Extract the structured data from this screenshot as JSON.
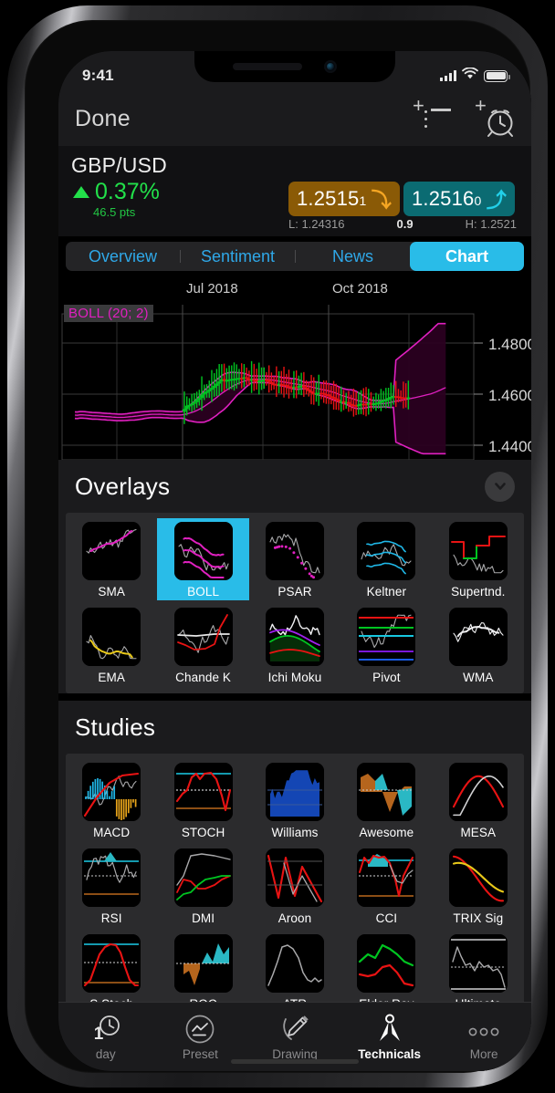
{
  "status_bar": {
    "time": "9:41",
    "signal_icon": "cellular-bars-icon",
    "wifi_icon": "wifi-icon",
    "battery_icon": "battery-icon"
  },
  "nav": {
    "done_label": "Done",
    "add_watchlist_icon": "add-to-watchlist-icon",
    "add_alarm_icon": "add-alarm-icon"
  },
  "quote": {
    "symbol": "GBP/USD",
    "change_percent": "0.37%",
    "change_direction_icon": "triangle-up-icon",
    "points": "46.5 pts",
    "bid": {
      "price": "1.2515",
      "last_digit": "1",
      "arrow_icon": "arrow-down-icon"
    },
    "ask": {
      "price": "1.2516",
      "last_digit": "0",
      "arrow_icon": "arrow-up-icon"
    },
    "low_label": "L: 1.24316",
    "spread": "0.9",
    "high_label": "H: 1.2521",
    "accent_bid": "#8a5a06",
    "accent_ask": "#0b6b72",
    "accent_up": "#22e04a"
  },
  "tabs": [
    {
      "label": "Overview",
      "active": false
    },
    {
      "label": "Sentiment",
      "active": false
    },
    {
      "label": "News",
      "active": false
    },
    {
      "label": "Chart",
      "active": true
    }
  ],
  "chart_data": {
    "type": "line",
    "title": "",
    "indicator_badge": "BOLL (20; 2)",
    "indicator_color": "#e020c0",
    "xlabel": "",
    "ylabel": "",
    "x_tick_labels": [
      "Jul 2018",
      "Oct 2018"
    ],
    "y_tick_labels": [
      "1.4800",
      "1.4600",
      "1.4400"
    ],
    "ylim": [
      1.428,
      1.488
    ],
    "grid": true,
    "series": [
      {
        "name": "Bollinger Upper",
        "color": "#e020c0"
      },
      {
        "name": "Bollinger Lower",
        "color": "#e020c0"
      },
      {
        "name": "Price Candles",
        "up_color": "#00c521",
        "down_color": "#e81313"
      }
    ]
  },
  "overlays": {
    "title": "Overlays",
    "collapse_icon": "chevron-down-icon",
    "items": [
      {
        "label": "SMA",
        "selected": false
      },
      {
        "label": "BOLL",
        "selected": true
      },
      {
        "label": "PSAR",
        "selected": false
      },
      {
        "label": "Keltner",
        "selected": false
      },
      {
        "label": "Supertnd.",
        "selected": false
      },
      {
        "label": "EMA",
        "selected": false
      },
      {
        "label": "Chande K",
        "selected": false
      },
      {
        "label": "Ichi Moku",
        "selected": false
      },
      {
        "label": "Pivot",
        "selected": false
      },
      {
        "label": "WMA",
        "selected": false
      }
    ]
  },
  "studies": {
    "title": "Studies",
    "items": [
      {
        "label": "MACD",
        "selected": false
      },
      {
        "label": "STOCH",
        "selected": false
      },
      {
        "label": "Williams",
        "selected": false
      },
      {
        "label": "Awesome",
        "selected": false
      },
      {
        "label": "MESA",
        "selected": false
      },
      {
        "label": "RSI",
        "selected": false
      },
      {
        "label": "DMI",
        "selected": false
      },
      {
        "label": "Aroon",
        "selected": false
      },
      {
        "label": "CCI",
        "selected": false
      },
      {
        "label": "TRIX Sig",
        "selected": false
      },
      {
        "label": "S Stoch",
        "selected": false
      },
      {
        "label": "ROC",
        "selected": false
      },
      {
        "label": "ATR",
        "selected": false
      },
      {
        "label": "Elder Ray",
        "selected": false
      },
      {
        "label": "Ultimate",
        "selected": false
      }
    ]
  },
  "toolbar": [
    {
      "label": "day",
      "value": "1",
      "icon": "clock-icon",
      "active": false
    },
    {
      "label": "Preset",
      "icon": "preset-chart-icon",
      "active": false
    },
    {
      "label": "Drawing",
      "icon": "pencil-icon",
      "active": false
    },
    {
      "label": "Technicals",
      "icon": "compass-divider-icon",
      "active": true
    },
    {
      "label": "More",
      "icon": "ellipsis-icon",
      "active": false
    }
  ]
}
